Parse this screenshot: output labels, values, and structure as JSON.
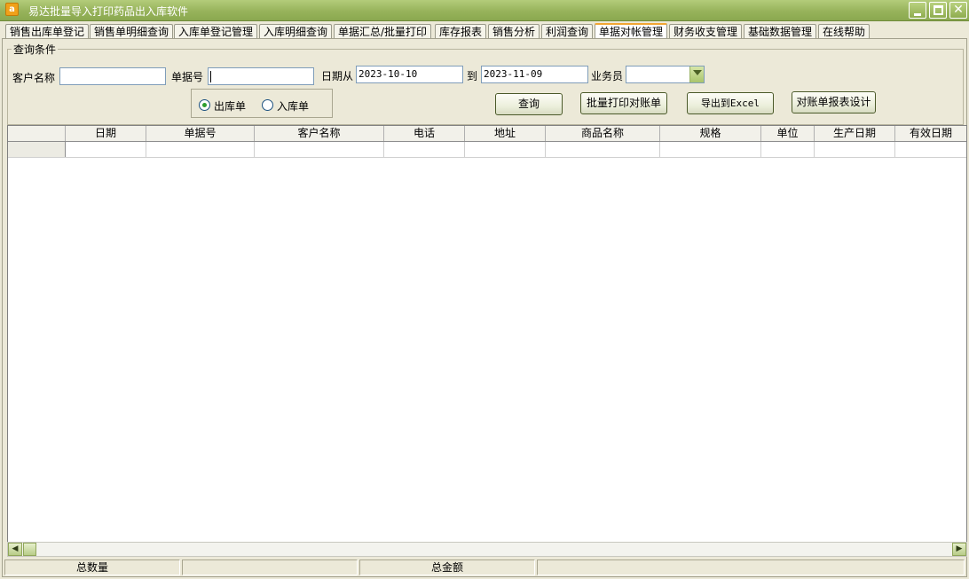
{
  "window": {
    "title": "易达批量导入打印药品出入库软件",
    "app_icon_glyph": "a"
  },
  "tabs": [
    {
      "label": "销售出库单登记",
      "active": false
    },
    {
      "label": "销售单明细查询",
      "active": false
    },
    {
      "label": "入库单登记管理",
      "active": false
    },
    {
      "label": "入库明细查询",
      "active": false
    },
    {
      "label": "单据汇总/批量打印",
      "active": false
    },
    {
      "label": "库存报表",
      "active": false
    },
    {
      "label": "销售分析",
      "active": false
    },
    {
      "label": "利润查询",
      "active": false
    },
    {
      "label": "单据对帐管理",
      "active": true
    },
    {
      "label": "财务收支管理",
      "active": false
    },
    {
      "label": "基础数据管理",
      "active": false
    },
    {
      "label": "在线帮助",
      "active": false
    }
  ],
  "query": {
    "group_title": "查询条件",
    "customer_label": "客户名称",
    "customer_value": "",
    "doc_no_label": "单据号",
    "doc_no_value": "",
    "date_from_label": "日期从",
    "date_from_value": "2023-10-10",
    "date_to_label": "到",
    "date_to_value": "2023-11-09",
    "salesman_label": "业务员",
    "salesman_value": "",
    "radio_out_label": "出库单",
    "radio_in_label": "入库单",
    "radio_selected": "out",
    "btn_query": "查询",
    "btn_batch_print": "批量打印对账单",
    "btn_export": "导出到Excel",
    "btn_design": "对账单报表设计"
  },
  "grid": {
    "columns": [
      "日期",
      "单据号",
      "客户名称",
      "电话",
      "地址",
      "商品名称",
      "规格",
      "单位",
      "生产日期",
      "有效日期"
    ]
  },
  "status": {
    "total_qty_label": "总数量",
    "total_qty_value": "",
    "total_amount_label": "总金额",
    "total_amount_value": ""
  },
  "colors": {
    "titlebar": "#97b35b",
    "active_tab_accent": "#f2a633",
    "radio_dot": "#2e9e2e"
  }
}
